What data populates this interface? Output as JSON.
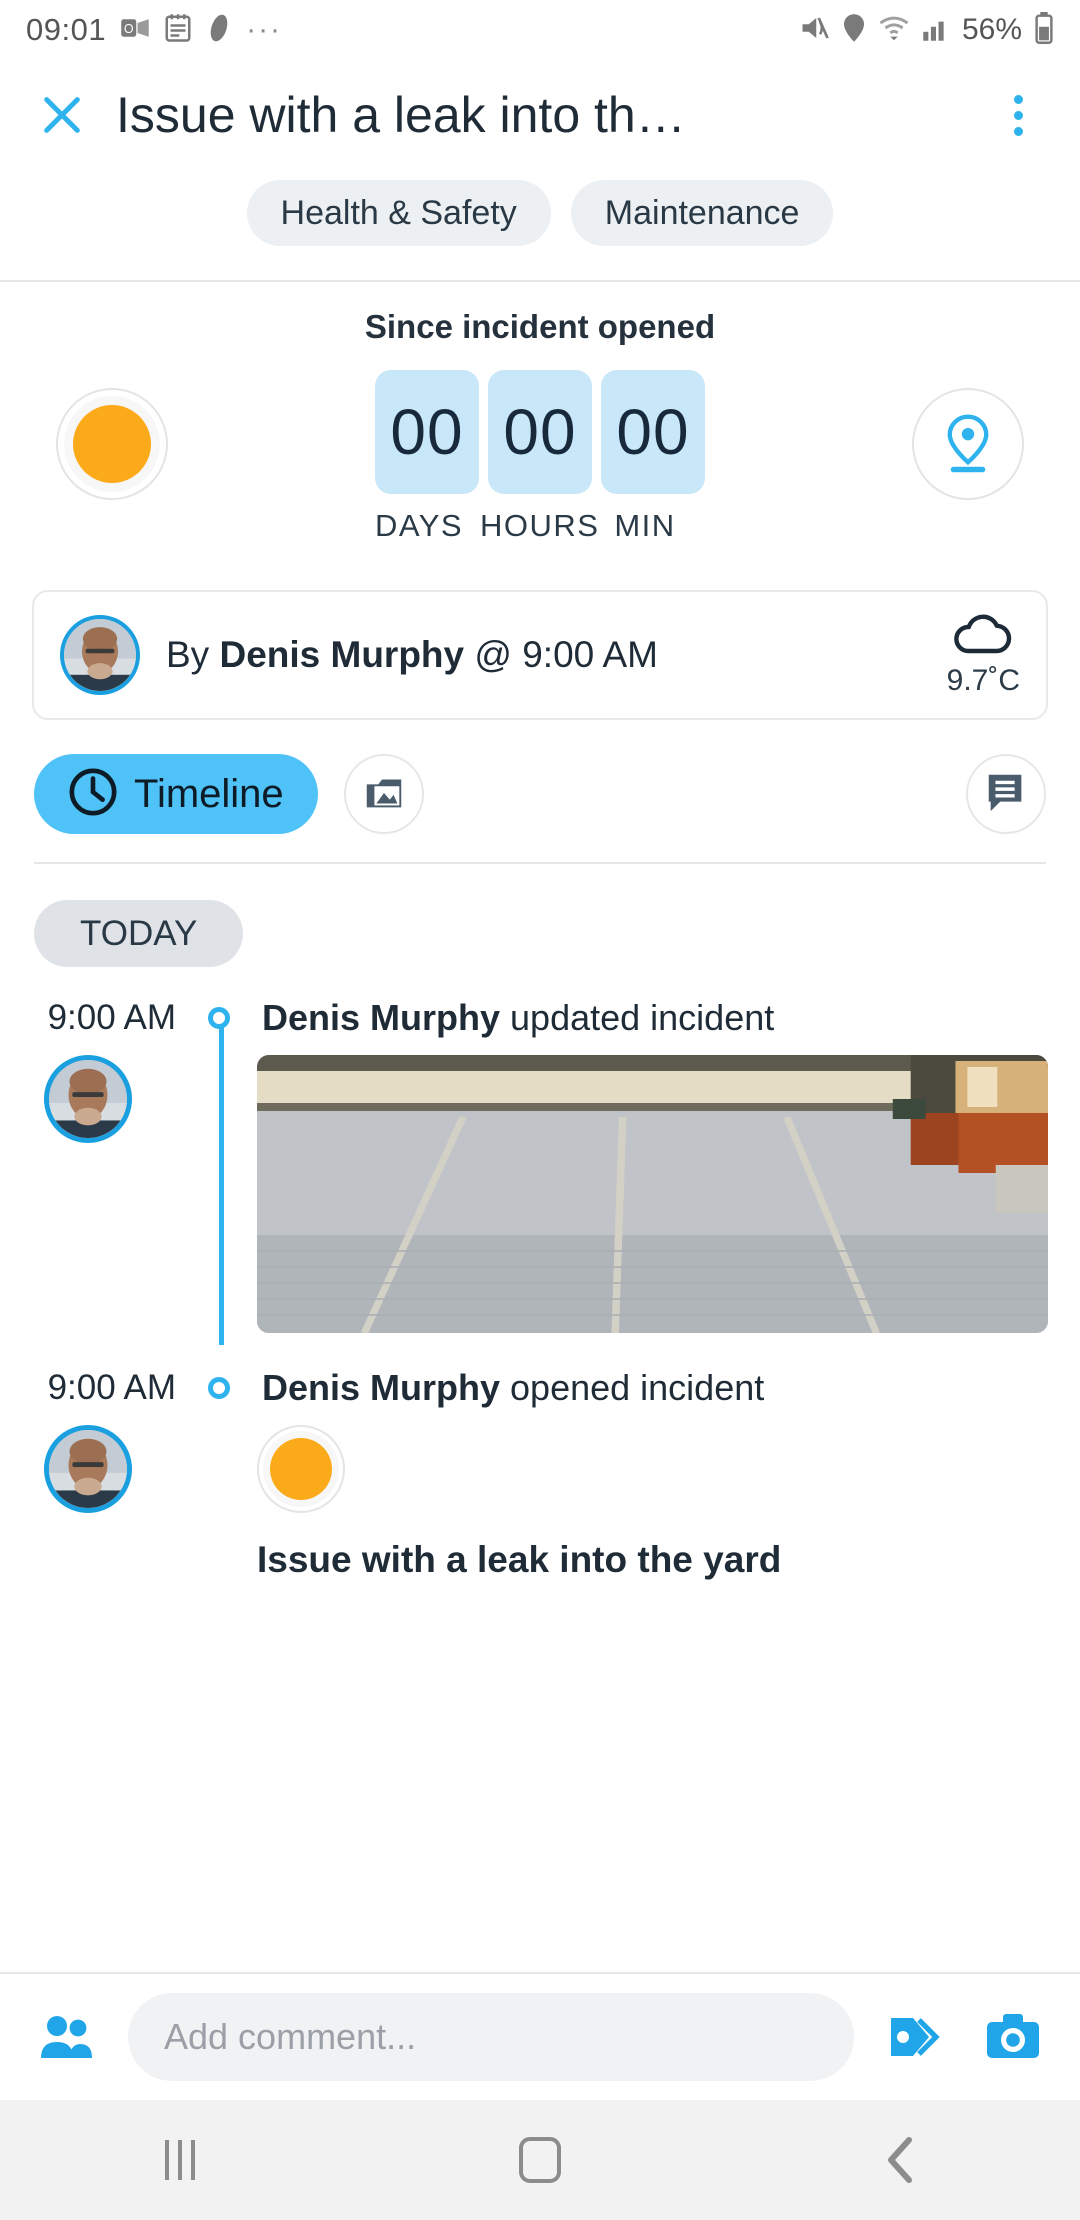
{
  "statusbar": {
    "time": "09:01",
    "battery": "56%",
    "overflow_dots": "···",
    "icons": [
      "outlook-icon",
      "notes-icon",
      "feather-icon",
      "more-icon",
      "mute-icon",
      "location-icon",
      "wifi-icon",
      "signal-icon",
      "battery-icon"
    ]
  },
  "header": {
    "close_icon": "close-icon",
    "title": "Issue with a leak into th…",
    "menu_icon": "kebab-menu-icon",
    "tags": [
      "Health & Safety",
      "Maintenance"
    ]
  },
  "timer": {
    "heading": "Since incident opened",
    "status_color": "#fbaa19",
    "values": [
      "00",
      "00",
      "00"
    ],
    "units": [
      "DAYS",
      "HOURS",
      "MIN"
    ],
    "location_icon": "location-pin-icon"
  },
  "author": {
    "prefix": "By ",
    "name": "Denis Murphy",
    "suffix": " @ 9:00 AM",
    "weather_icon": "cloud-icon",
    "temperature": "9.7˚C"
  },
  "tabs": {
    "timeline_label": "Timeline",
    "timeline_icon": "clock-icon",
    "media_icon": "media-folder-icon",
    "chat_icon": "chat-bubble-icon"
  },
  "timeline": {
    "day_badge": "TODAY",
    "entries": [
      {
        "time": "9:00 AM",
        "actor": "Denis Murphy",
        "action": " updated incident",
        "attachment": "photo"
      },
      {
        "time": "9:00 AM",
        "actor": "Denis Murphy",
        "action": " opened incident",
        "attachment": "status-orb",
        "incident_title": "Issue with a leak into the yard"
      }
    ]
  },
  "commentbar": {
    "people_icon": "people-icon",
    "placeholder": "Add comment...",
    "tag_icon": "tags-icon",
    "camera_icon": "camera-icon"
  },
  "navbar": {
    "recents_icon": "recents-icon",
    "home_icon": "home-icon",
    "back_icon": "back-icon"
  },
  "colors": {
    "accent": "#2eb3ef",
    "tab_active": "#4fc3f7",
    "status_orange": "#fbaa19",
    "digit_bg": "#c8e7f8"
  }
}
